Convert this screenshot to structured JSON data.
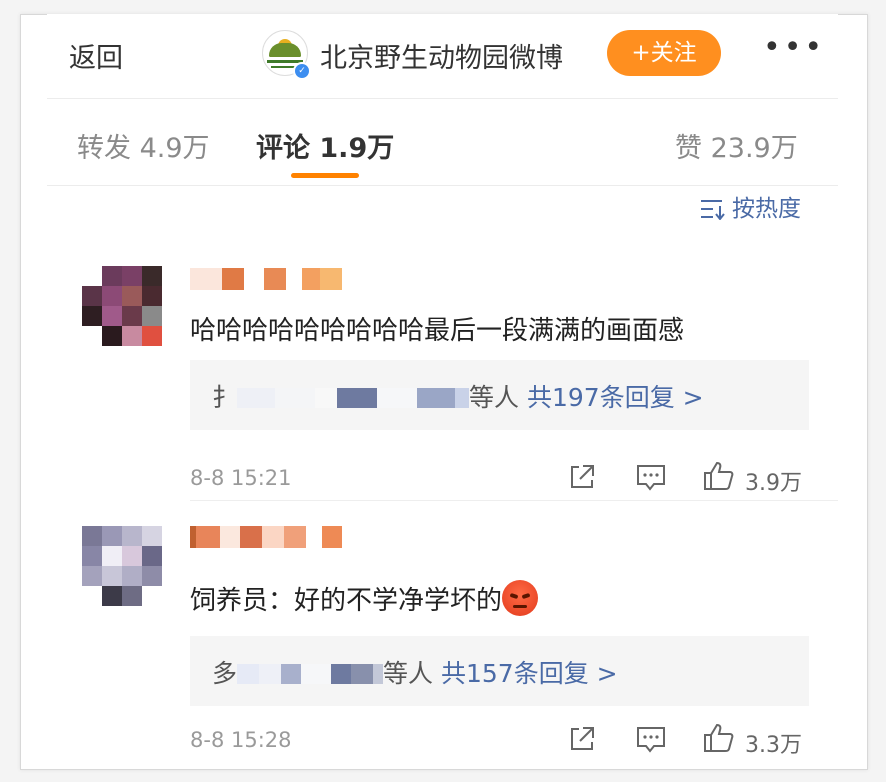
{
  "header": {
    "back_label": "返回",
    "account_name": "北京野生动物园微博",
    "follow_label": "+关注",
    "more_label": "•••"
  },
  "tabs": {
    "repost": "转发 4.9万",
    "comment": "评论 1.9万",
    "like": "赞 23.9万"
  },
  "sort_label": "按热度",
  "comments": [
    {
      "text": "哈哈哈哈哈哈哈哈哈最后一段满满的画面感",
      "reply_prefix": "扌",
      "reply_suffix": "等人",
      "reply_count": "共197条回复 >",
      "time": "8-8 15:21",
      "likes": "3.9万"
    },
    {
      "text": "饲养员：好的不学净学坏的",
      "reply_prefix": "多",
      "reply_suffix": "等人",
      "reply_count": "共157条回复 >",
      "time": "8-8 15:28",
      "likes": "3.3万"
    }
  ],
  "colors": {
    "accent": "#ff8200",
    "link": "#4a6aa6",
    "follow_bg": "#ff8f1f"
  }
}
